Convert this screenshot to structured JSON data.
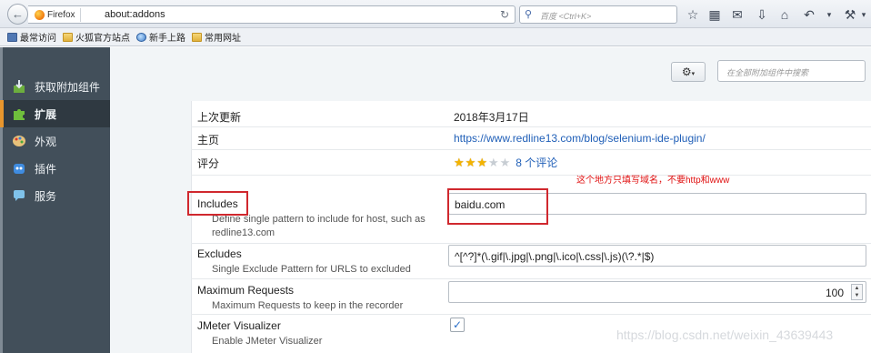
{
  "toolbar": {
    "identity_label": "Firefox",
    "url": "about:addons",
    "search_placeholder": "百度 <Ctrl+K>"
  },
  "bookmarks": [
    {
      "label": "最常访问",
      "icon": "most-visited-icon"
    },
    {
      "label": "火狐官方站点",
      "icon": "folder-icon"
    },
    {
      "label": "新手上路",
      "icon": "globe-icon"
    },
    {
      "label": "常用网址",
      "icon": "folder-icon"
    }
  ],
  "sidebar": {
    "items": [
      {
        "label": "获取附加组件",
        "icon": "get-addons-icon"
      },
      {
        "label": "扩展",
        "icon": "puzzle-icon",
        "selected": true
      },
      {
        "label": "外观",
        "icon": "palette-icon"
      },
      {
        "label": "插件",
        "icon": "plugin-icon"
      },
      {
        "label": "服务",
        "icon": "services-icon"
      }
    ]
  },
  "main": {
    "search_placeholder": "在全部附加组件中搜索"
  },
  "details": {
    "last_updated_label": "上次更新",
    "last_updated_value": "2018年3月17日",
    "homepage_label": "主页",
    "homepage_value": "https://www.redline13.com/blog/selenium-ide-plugin/",
    "rating_label": "评分",
    "rating_value": 3,
    "rating_max": 5,
    "reviews_link": "8 个评论"
  },
  "annotation": "这个地方只填写域名，不要http和www",
  "prefs": {
    "includes": {
      "label": "Includes",
      "description": "Define single pattern to include for host, such as redline13.com",
      "value": "baidu.com"
    },
    "excludes": {
      "label": "Excludes",
      "description": "Single Exclude Pattern for URLS to excluded",
      "value": "^[^?]*(\\.gif|\\.jpg|\\.png|\\.ico|\\.css|\\.js)(\\?.*|$)"
    },
    "max_requests": {
      "label": "Maximum Requests",
      "description": "Maximum Requests to keep in the recorder",
      "value": "100"
    },
    "jmeter": {
      "label": "JMeter Visualizer",
      "description": "Enable JMeter Visualizer",
      "checked": true
    }
  },
  "watermark": "https://blog.csdn.net/weixin_43639443"
}
